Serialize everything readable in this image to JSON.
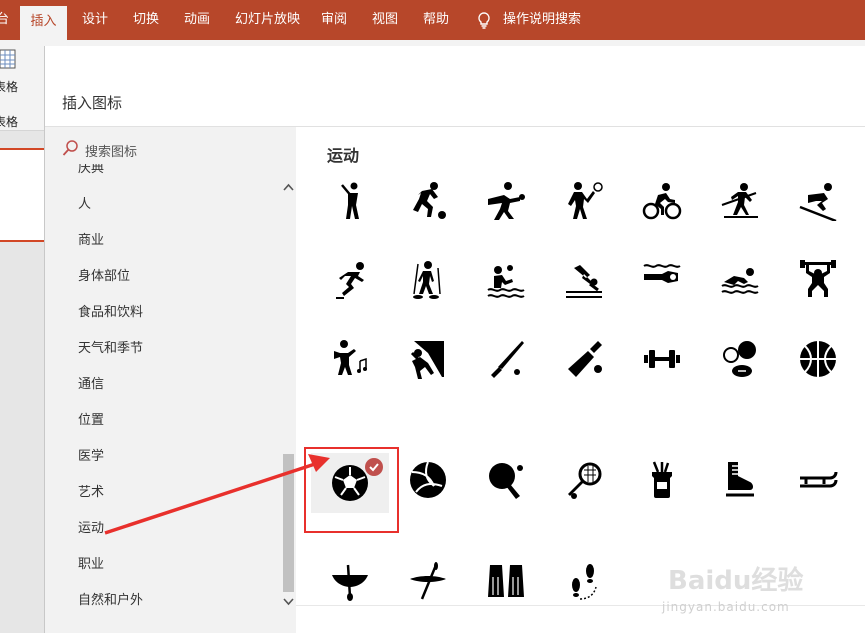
{
  "ribbon": {
    "tabs": [
      {
        "label": "台",
        "active": false
      },
      {
        "label": "插入",
        "active": true
      },
      {
        "label": "设计",
        "active": false
      },
      {
        "label": "切换",
        "active": false
      },
      {
        "label": "动画",
        "active": false
      },
      {
        "label": "幻灯片放映",
        "active": false
      },
      {
        "label": "审阅",
        "active": false
      },
      {
        "label": "视图",
        "active": false
      },
      {
        "label": "帮助",
        "active": false
      }
    ],
    "tell_me": "操作说明搜索",
    "table_label": "表格",
    "table_group_label": "表格",
    "accent_color": "#b7472a"
  },
  "dialog": {
    "title": "插入图标",
    "search_placeholder": "搜索图标",
    "categories": [
      "庆典",
      "人",
      "商业",
      "身体部位",
      "食品和饮料",
      "天气和季节",
      "通信",
      "位置",
      "医学",
      "艺术",
      "运动",
      "职业",
      "自然和户外"
    ],
    "section_title": "运动",
    "icons": [
      [
        "baseball-player-icon",
        "soccer-player-icon",
        "softball-pitcher-icon",
        "tennis-player-icon",
        "cyclist-icon",
        "cross-country-skier-icon",
        "downhill-skier-icon"
      ],
      [
        "ice-skater-icon",
        "snowshoe-hiker-icon",
        "water-polo-icon",
        "diver-icon",
        "swimmer-underwater-icon",
        "swimmer-icon",
        "weightlifter-icon"
      ],
      [
        "dancer-icon",
        "rock-climber-icon",
        "baseball-bat-icon",
        "cricket-bat-icon",
        "dumbbell-icon",
        "sports-balls-icon",
        "basketball-icon"
      ],
      [
        "soccer-ball-icon",
        "volleyball-icon",
        "ping-pong-icon",
        "tennis-racket-icon",
        "golf-bag-icon",
        "ice-skate-icon",
        "sled-icon"
      ],
      [
        "canoe-icon",
        "kayak-icon",
        "swim-fins-icon",
        "footprints-icon"
      ]
    ],
    "selected_icon": "soccer-ball-icon",
    "selection_color": "#e8302c"
  },
  "watermark": {
    "logo": "Baidu经验",
    "url": "jingyan.baidu.com"
  }
}
